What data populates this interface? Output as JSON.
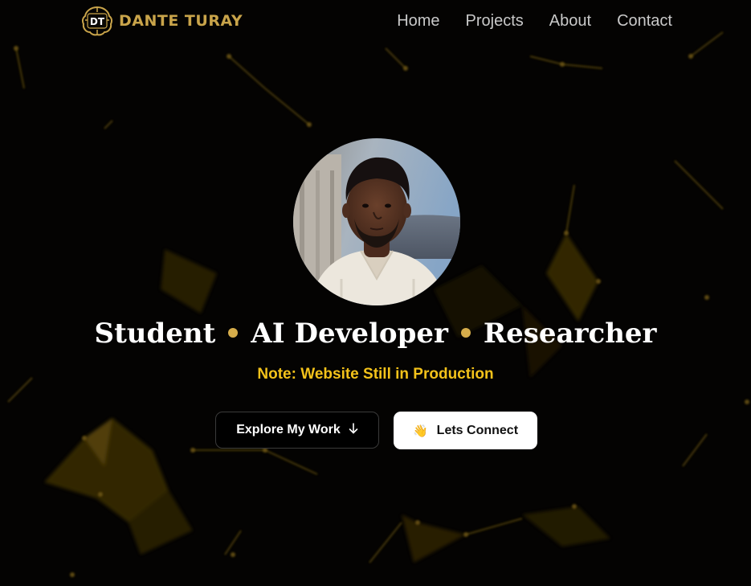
{
  "header": {
    "logo_initials": "DT",
    "brand_name": "DANTE TURAY",
    "nav": [
      {
        "label": "Home"
      },
      {
        "label": "Projects"
      },
      {
        "label": "About"
      },
      {
        "label": "Contact"
      }
    ]
  },
  "hero": {
    "roles": [
      "Student",
      "AI Developer",
      "Researcher"
    ],
    "note": "Note: Website Still in Production",
    "explore_button": "Explore My Work",
    "connect_button": "Lets Connect",
    "connect_emoji": "👋"
  },
  "icons": {
    "explore_arrow": "arrow-down-icon",
    "connect_wave": "waving-hand-icon",
    "logo": "brain-circuit-logo"
  },
  "colors": {
    "background": "#040302",
    "accent_gold": "#c9a44a",
    "note_yellow": "#f3c21a",
    "nav_text": "#c9c9c9",
    "button_light": "#ffffff",
    "button_dark": "#000000"
  }
}
